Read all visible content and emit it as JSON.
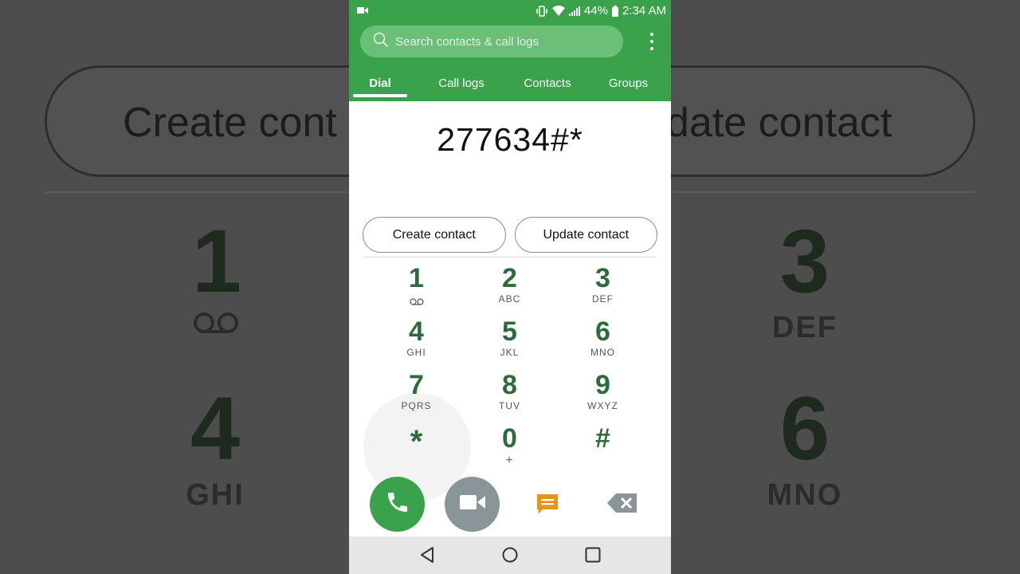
{
  "background": {
    "pill_left_text": "Create cont",
    "pill_right_text": "date contact",
    "keys": [
      {
        "digit": "1",
        "letters": ""
      },
      {
        "digit": "3",
        "letters": "DEF"
      },
      {
        "digit": "4",
        "letters": "GHI"
      },
      {
        "digit": "6",
        "letters": "MNO"
      }
    ]
  },
  "status_bar": {
    "battery_percent": "44%",
    "time": "2:34 AM"
  },
  "search": {
    "placeholder": "Search contacts & call logs"
  },
  "tabs": [
    {
      "label": "Dial",
      "active": true
    },
    {
      "label": "Call logs",
      "active": false
    },
    {
      "label": "Contacts",
      "active": false
    },
    {
      "label": "Groups",
      "active": false
    }
  ],
  "dialer": {
    "number": "277634#*",
    "create_contact_label": "Create contact",
    "update_contact_label": "Update contact"
  },
  "keypad": [
    {
      "digit": "1",
      "letters": ""
    },
    {
      "digit": "2",
      "letters": "ABC"
    },
    {
      "digit": "3",
      "letters": "DEF"
    },
    {
      "digit": "4",
      "letters": "GHI"
    },
    {
      "digit": "5",
      "letters": "JKL"
    },
    {
      "digit": "6",
      "letters": "MNO"
    },
    {
      "digit": "7",
      "letters": "PQRS"
    },
    {
      "digit": "8",
      "letters": "TUV"
    },
    {
      "digit": "9",
      "letters": "WXYZ"
    },
    {
      "digit": "*",
      "letters": ""
    },
    {
      "digit": "0",
      "letters": "+"
    },
    {
      "digit": "#",
      "letters": ""
    }
  ],
  "icons": {
    "call": "phone-icon",
    "video": "video-camera-icon",
    "message": "message-icon",
    "delete": "backspace-icon",
    "back": "nav-back-icon",
    "home": "nav-home-icon",
    "recents": "nav-recents-icon"
  },
  "colors": {
    "accent_green": "#3aa24a",
    "digit_green": "#2f6a3b",
    "message_orange": "#e8941a",
    "video_grey": "#8a9599"
  }
}
